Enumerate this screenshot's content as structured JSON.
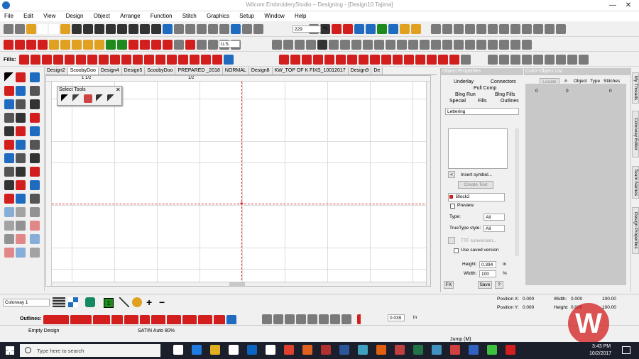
{
  "window": {
    "title": "Wilcom EmbroideryStudio – Designing - [Design10    Tajima]",
    "minimize": "—",
    "close": "✕"
  },
  "menu": [
    "File",
    "Edit",
    "View",
    "Design",
    "Object",
    "Arrange",
    "Function",
    "Stitch",
    "Graphics",
    "Setup",
    "Window",
    "Help"
  ],
  "toolbar": {
    "zoom_value": "229",
    "zoom_unit": "%",
    "units": "U.S."
  },
  "fills_label": "Fills:",
  "tabs": [
    "Design2",
    "ScoobyDoo",
    "Design4",
    "Design5",
    "ScoobyDoo",
    "PREPARED _2018",
    "NORMAL",
    "Design8",
    "KW_TOP OF K FIXS_10012017",
    "Design9",
    "De"
  ],
  "active_tab_index": 1,
  "ruler": {
    "tick1": "1 1/2",
    "tick2": "1/2"
  },
  "select_tools": {
    "title": "Select Tools",
    "close": "✕"
  },
  "object_properties": {
    "title": "Object Properties",
    "tabs": [
      "Underlay",
      "Connectors",
      "Pull Comp",
      "Blng Run",
      "Blng Fills",
      "Special",
      "Fills",
      "Outlines"
    ],
    "lettering_dropdown": "Lettering",
    "insert_symbol": "Insert symbol...",
    "create_text": "Create Text",
    "font": "Block2",
    "preview_label": "Preview",
    "type_label": "Type:",
    "type_value": "All",
    "truetype_label": "TrueType style:",
    "truetype_value": "All",
    "ttf_conversion": "TTF conversion...",
    "use_saved_version": "Use saved version",
    "height_label": "Height:",
    "height_value": "0.394",
    "height_unit": "in",
    "width_label": "Width:",
    "width_value": "100",
    "width_unit": "%",
    "fx": "FX",
    "save": "Save",
    "help": "?"
  },
  "color_object_list": {
    "title": "Color-Object List",
    "locate": "Locate",
    "columns": [
      "#",
      "Object",
      "Type",
      "Stitches"
    ],
    "row": [
      "0",
      "0",
      "0"
    ]
  },
  "side_tabs": [
    "My Threads",
    "Colorway Editor",
    "Team Names",
    "Design Properties"
  ],
  "bottom": {
    "colorway": "Colorway 1",
    "swatch_number": "1",
    "outlines_label": "Outlines:",
    "spacing_value": "0.039",
    "spacing_unit": "in",
    "position_x_label": "Position X:",
    "position_x": "0.000",
    "position_y_label": "Position Y:",
    "position_y": "0.000",
    "width_label": "Width:",
    "width": "0.000",
    "height_label": "Height:",
    "height": "0.000",
    "pct1": "100.00",
    "pct2": "100.00"
  },
  "status": {
    "left": "Empty Design",
    "mid": "SATIN Auto 80%",
    "right": "Jump (M)"
  },
  "taskbar": {
    "search": "Type here to search",
    "time": "3:43 PM",
    "date": "10/2/2017"
  },
  "colors": {
    "accent_red": "#d31e1e",
    "panel_header": "#c9c9c9",
    "guide": "#d33"
  }
}
